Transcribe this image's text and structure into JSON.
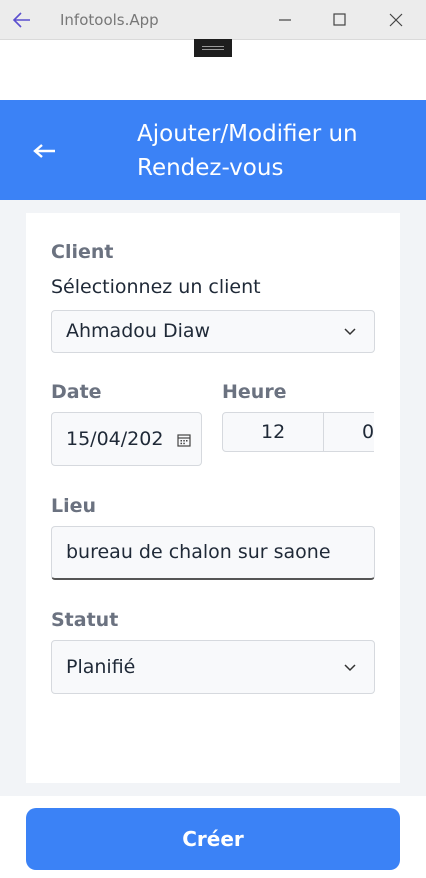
{
  "window": {
    "title": "Infotools.App"
  },
  "header": {
    "title": "Ajouter/Modifier un Rendez-vous"
  },
  "form": {
    "client_label": "Client",
    "client_prompt": "Sélectionnez un client",
    "client_value": "Ahmadou Diaw",
    "date_label": "Date",
    "date_value": "15/04/202",
    "time_label": "Heure",
    "hour_value": "12",
    "minute_value": "0",
    "lieu_label": "Lieu",
    "lieu_value": "bureau de chalon sur saone",
    "statut_label": "Statut",
    "statut_value": "Planifié"
  },
  "footer": {
    "create_label": "Créer"
  },
  "colors": {
    "accent": "#3b82f6",
    "window_accent": "#5b4fcf"
  },
  "icons": [
    "back-arrow-icon",
    "minimize-icon",
    "maximize-icon",
    "close-icon",
    "chevron-down-icon",
    "calendar-icon"
  ]
}
